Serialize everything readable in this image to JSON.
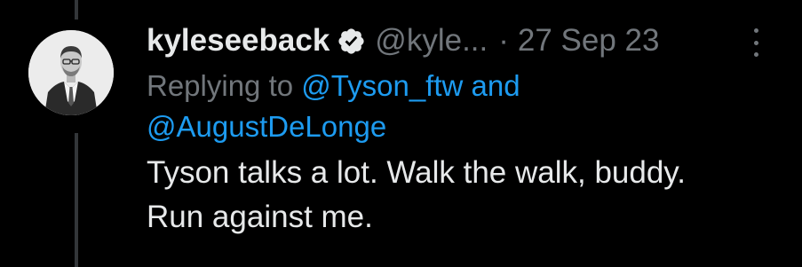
{
  "tweet": {
    "display_name": "kyleseeback",
    "handle": "@kyle...",
    "separator": "·",
    "date": "27 Sep 23",
    "replying_to_prefix": "Replying to",
    "mention_1": "@Tyson_ftw",
    "conjunction": "and",
    "mention_2": "@AugustDeLonge",
    "text_line_1": "Tyson talks a lot. Walk the walk, buddy.",
    "text_line_2": "Run against me."
  },
  "icons": {
    "verified": "verified-badge-icon",
    "more": "more-options-icon"
  },
  "colors": {
    "background": "#000000",
    "text": "#e7e9ea",
    "muted": "#71767b",
    "link": "#1d9bf0",
    "thread_line": "#333639"
  }
}
